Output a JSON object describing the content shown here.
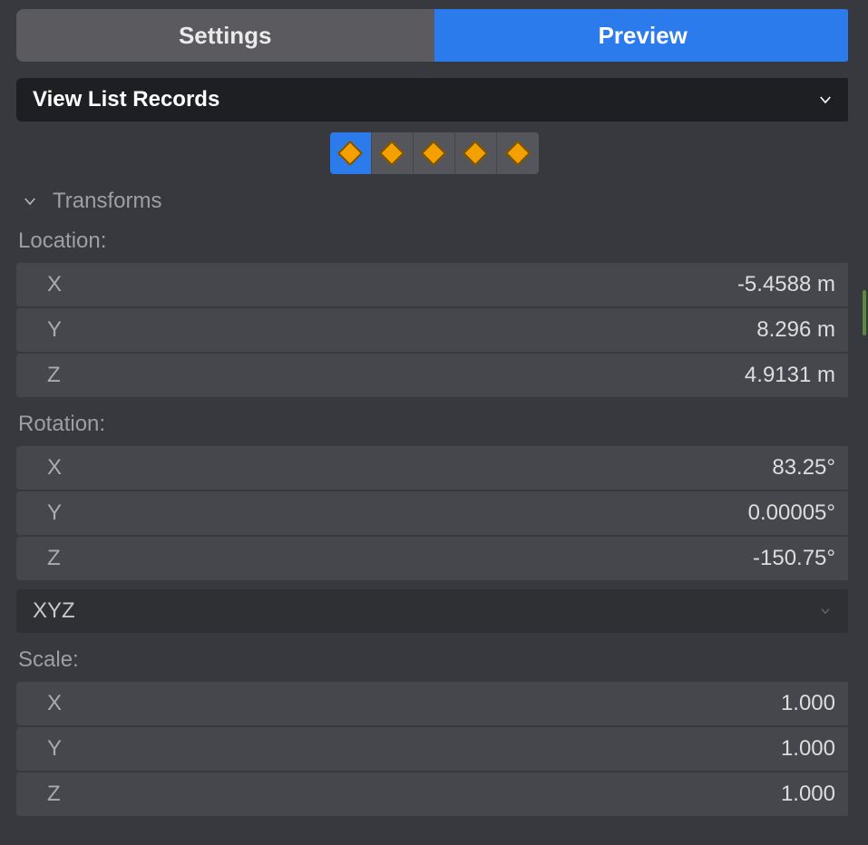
{
  "tabs": {
    "settings": "Settings",
    "preview": "Preview"
  },
  "dropdown": {
    "label": "View List Records"
  },
  "keyframes": {
    "count": 5,
    "selected_index": 0
  },
  "section": {
    "transforms": "Transforms"
  },
  "location": {
    "label": "Location:",
    "x_label": "X",
    "x_value": "-5.4588 m",
    "y_label": "Y",
    "y_value": "8.296 m",
    "z_label": "Z",
    "z_value": "4.9131 m"
  },
  "rotation": {
    "label": "Rotation:",
    "x_label": "X",
    "x_value": "83.25°",
    "y_label": "Y",
    "y_value": "0.00005°",
    "z_label": "Z",
    "z_value": "-150.75°",
    "mode": "XYZ"
  },
  "scale": {
    "label": "Scale:",
    "x_label": "X",
    "x_value": "1.000",
    "y_label": "Y",
    "y_value": "1.000",
    "z_label": "Z",
    "z_value": "1.000"
  }
}
